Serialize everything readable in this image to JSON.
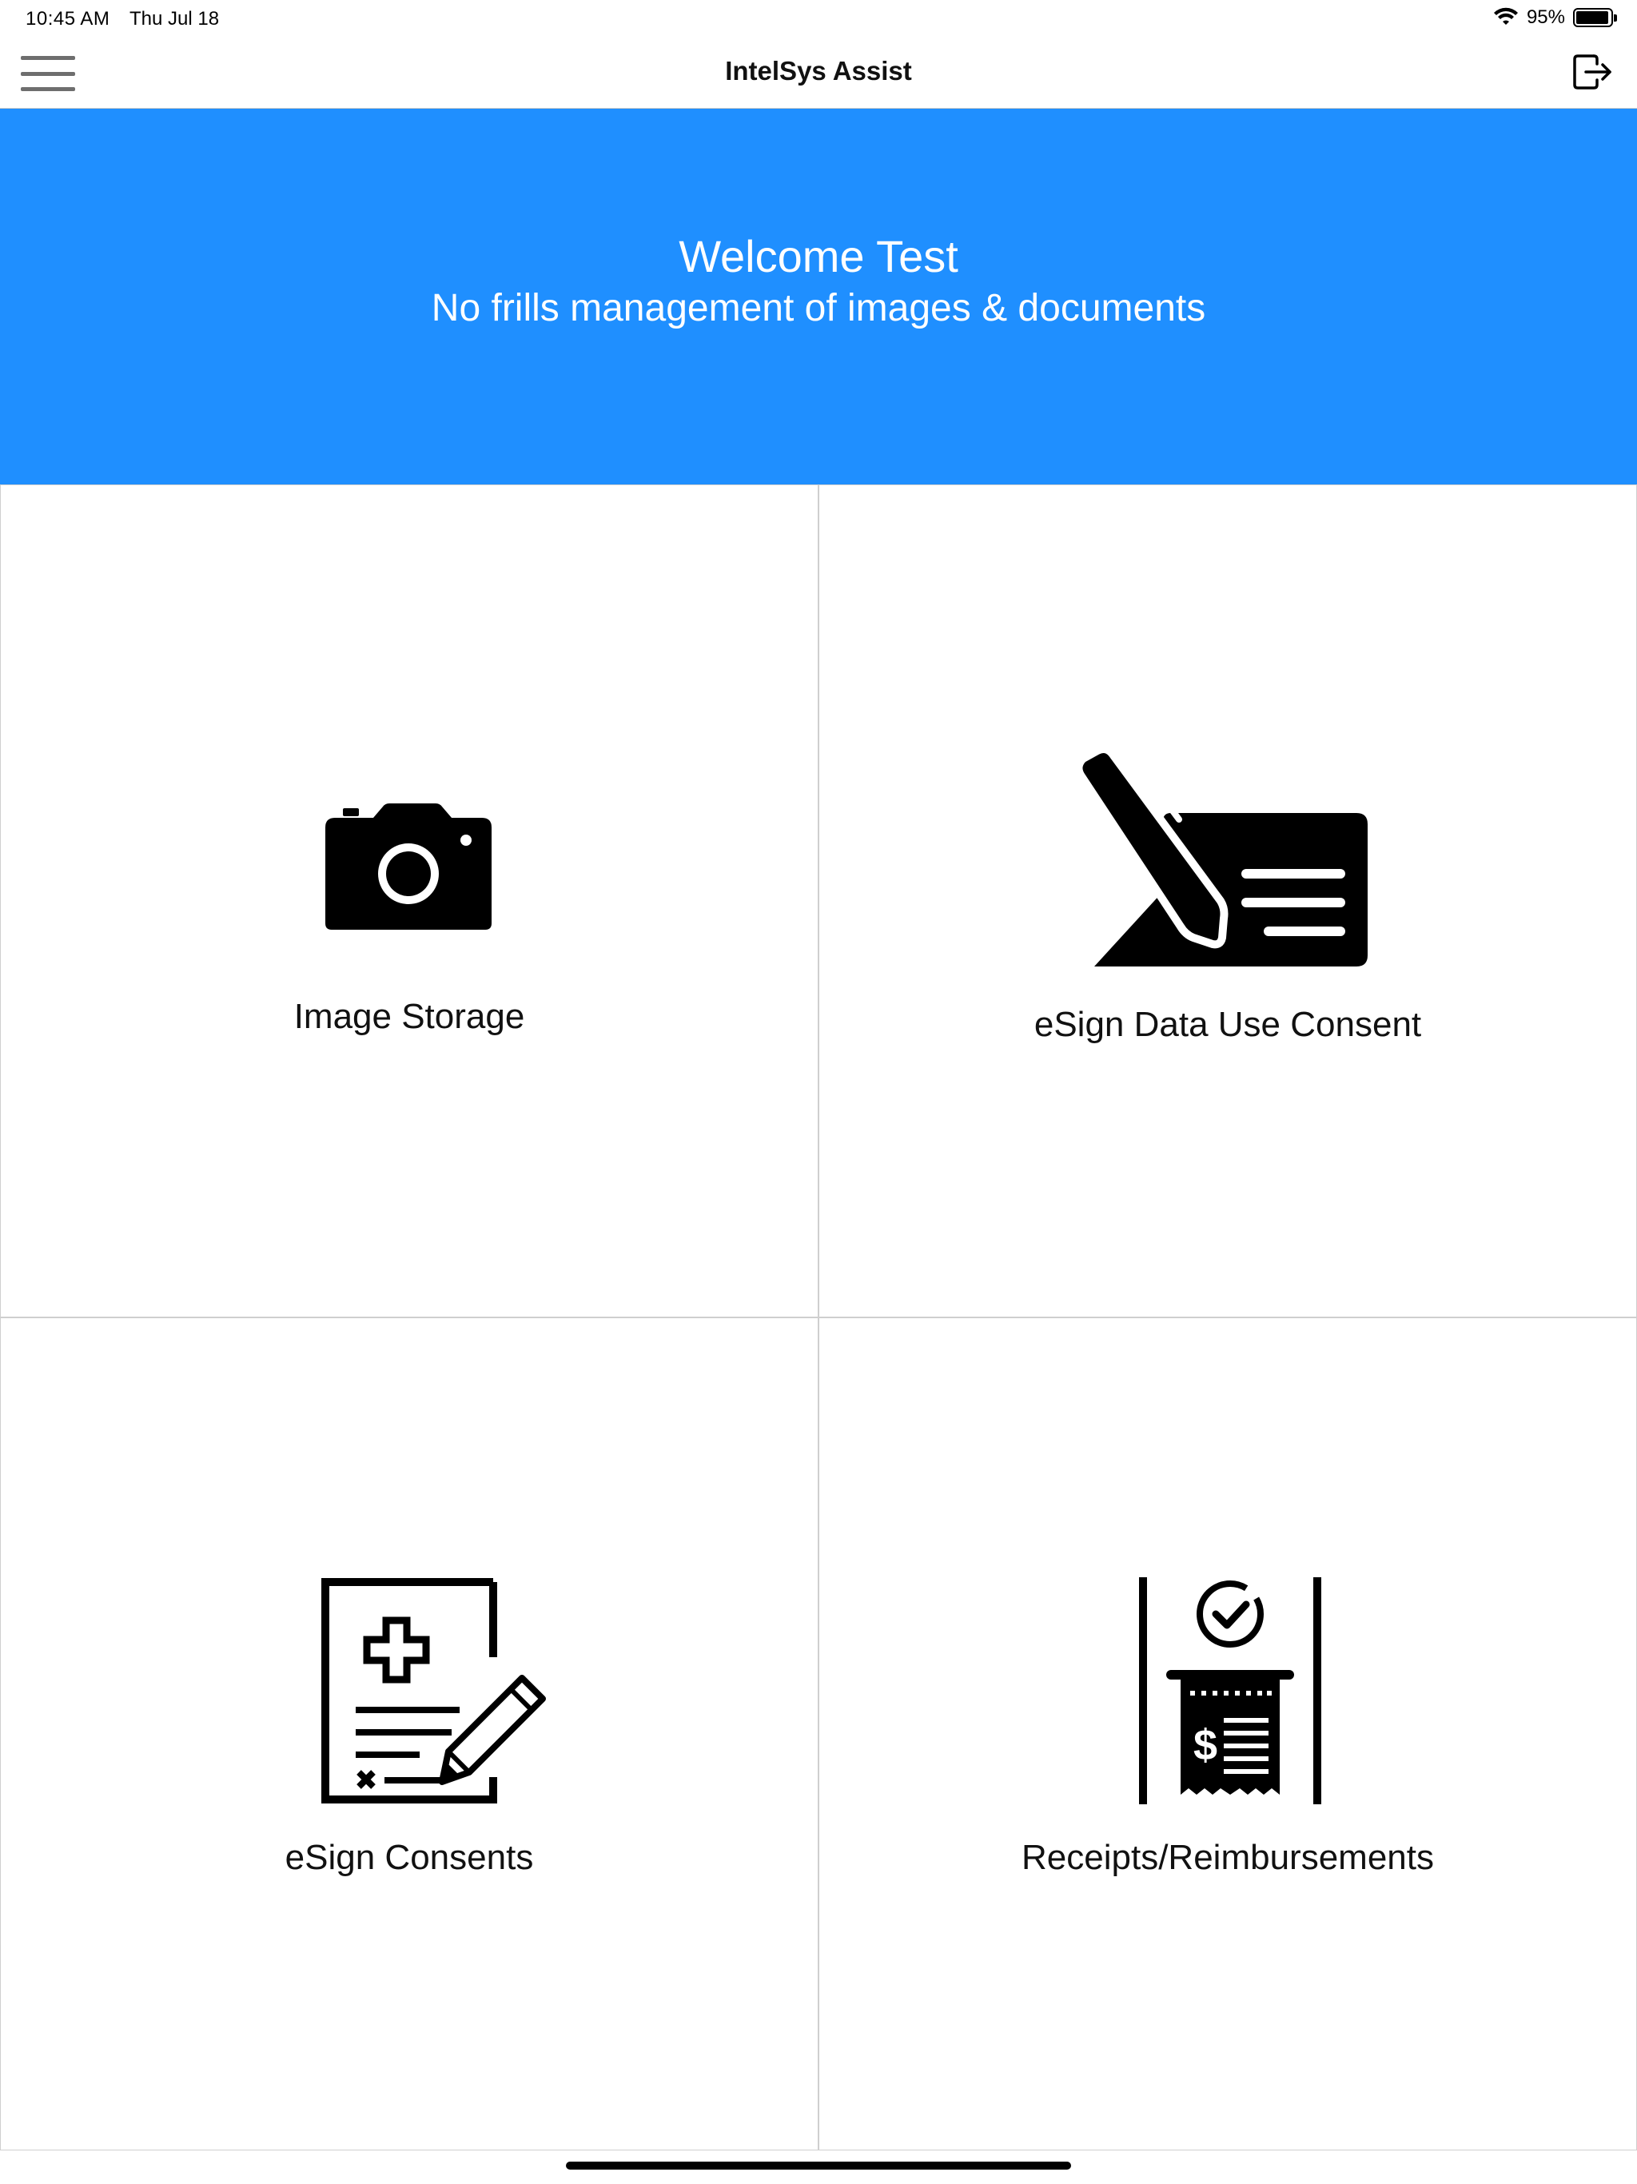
{
  "status_bar": {
    "time": "10:45 AM",
    "date": "Thu Jul 18",
    "battery_text": "95%",
    "battery_level": 0.95
  },
  "nav": {
    "title": "IntelSys Assist",
    "menu_icon": "hamburger-icon",
    "logout_icon": "logout-icon"
  },
  "banner": {
    "title": "Welcome Test",
    "subtitle": "No frills management of images & documents",
    "background_color": "#1f8fff"
  },
  "tiles": [
    {
      "label": "Image Storage",
      "icon": "camera-icon"
    },
    {
      "label": "eSign Data Use Consent",
      "icon": "signature-pen-icon"
    },
    {
      "label": "eSign Consents",
      "icon": "medical-document-sign-icon"
    },
    {
      "label": "Receipts/Reimbursements",
      "icon": "receipt-icon"
    }
  ]
}
